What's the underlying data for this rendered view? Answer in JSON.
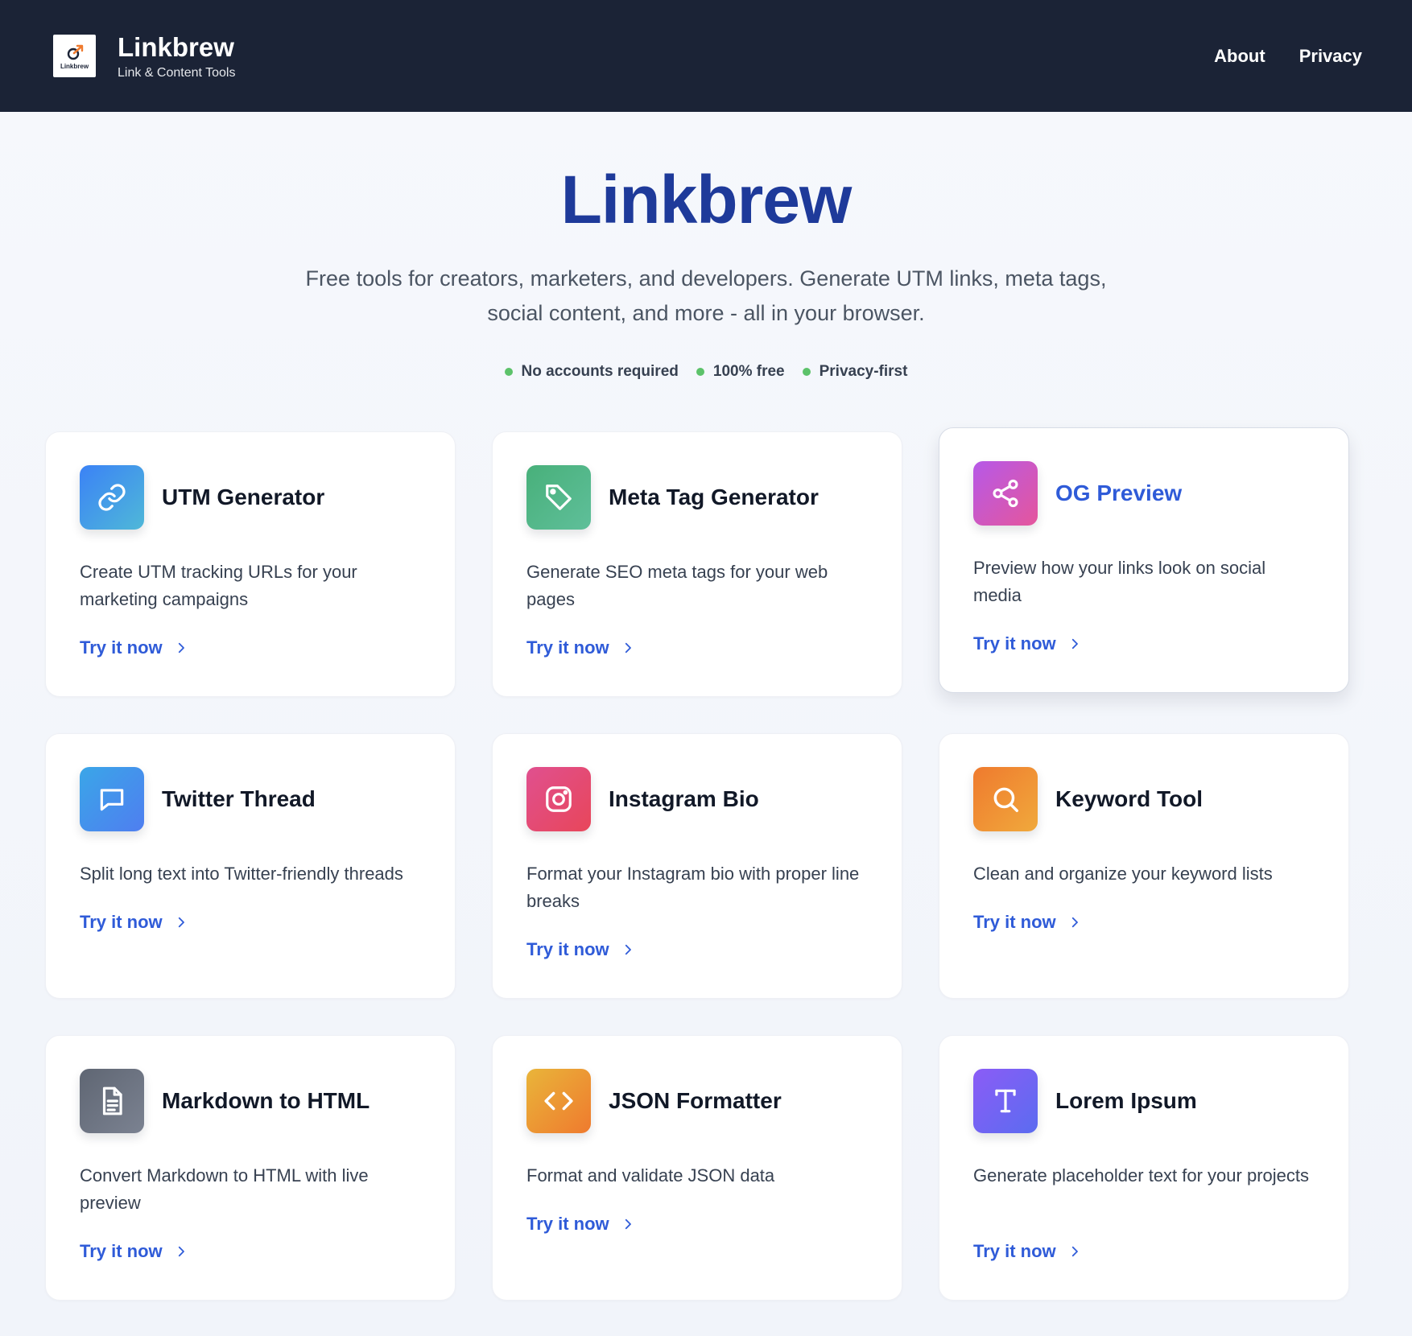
{
  "header": {
    "logo_text": "Linkbrew",
    "brand_name": "Linkbrew",
    "tagline": "Link & Content Tools",
    "nav": [
      {
        "label": "About"
      },
      {
        "label": "Privacy"
      }
    ]
  },
  "hero": {
    "title": "Linkbrew",
    "subtitle": "Free tools for creators, marketers, and developers. Generate UTM links, meta tags, social content, and more - all in your browser.",
    "badges": [
      {
        "label": "No accounts required"
      },
      {
        "label": "100% free"
      },
      {
        "label": "Privacy-first"
      }
    ]
  },
  "tools": [
    {
      "title": "UTM Generator",
      "description": "Create UTM tracking URLs for your marketing campaigns",
      "cta": "Try it now",
      "icon": "link-icon",
      "colors": [
        "#3b82f6",
        "#4fb8d8"
      ]
    },
    {
      "title": "Meta Tag Generator",
      "description": "Generate SEO meta tags for your web pages",
      "cta": "Try it now",
      "icon": "tag-icon",
      "colors": [
        "#48b07a",
        "#5fbf9a"
      ]
    },
    {
      "title": "OG Preview",
      "description": "Preview how your links look on social media",
      "cta": "Try it now",
      "icon": "share-icon",
      "colors": [
        "#b659e8",
        "#e5569c"
      ]
    },
    {
      "title": "Twitter Thread",
      "description": "Split long text into Twitter-friendly threads",
      "cta": "Try it now",
      "icon": "message-icon",
      "colors": [
        "#3aa6e8",
        "#4f7ef0"
      ]
    },
    {
      "title": "Instagram Bio",
      "description": "Format your Instagram bio with proper line breaks",
      "cta": "Try it now",
      "icon": "instagram-icon",
      "colors": [
        "#e0508f",
        "#e8465a"
      ]
    },
    {
      "title": "Keyword Tool",
      "description": "Clean and organize your keyword lists",
      "cta": "Try it now",
      "icon": "search-icon",
      "colors": [
        "#ef7a2e",
        "#f0a93c"
      ]
    },
    {
      "title": "Markdown to HTML",
      "description": "Convert Markdown to HTML with live preview",
      "cta": "Try it now",
      "icon": "document-icon",
      "colors": [
        "#5f6673",
        "#7b8291"
      ]
    },
    {
      "title": "JSON Formatter",
      "description": "Format and validate JSON data",
      "cta": "Try it now",
      "icon": "code-icon",
      "colors": [
        "#e9b53a",
        "#ef7a2e"
      ]
    },
    {
      "title": "Lorem Ipsum",
      "description": "Generate placeholder text for your projects",
      "cta": "Try it now",
      "icon": "text-icon",
      "colors": [
        "#8b5cf6",
        "#5b6cf0"
      ]
    }
  ]
}
